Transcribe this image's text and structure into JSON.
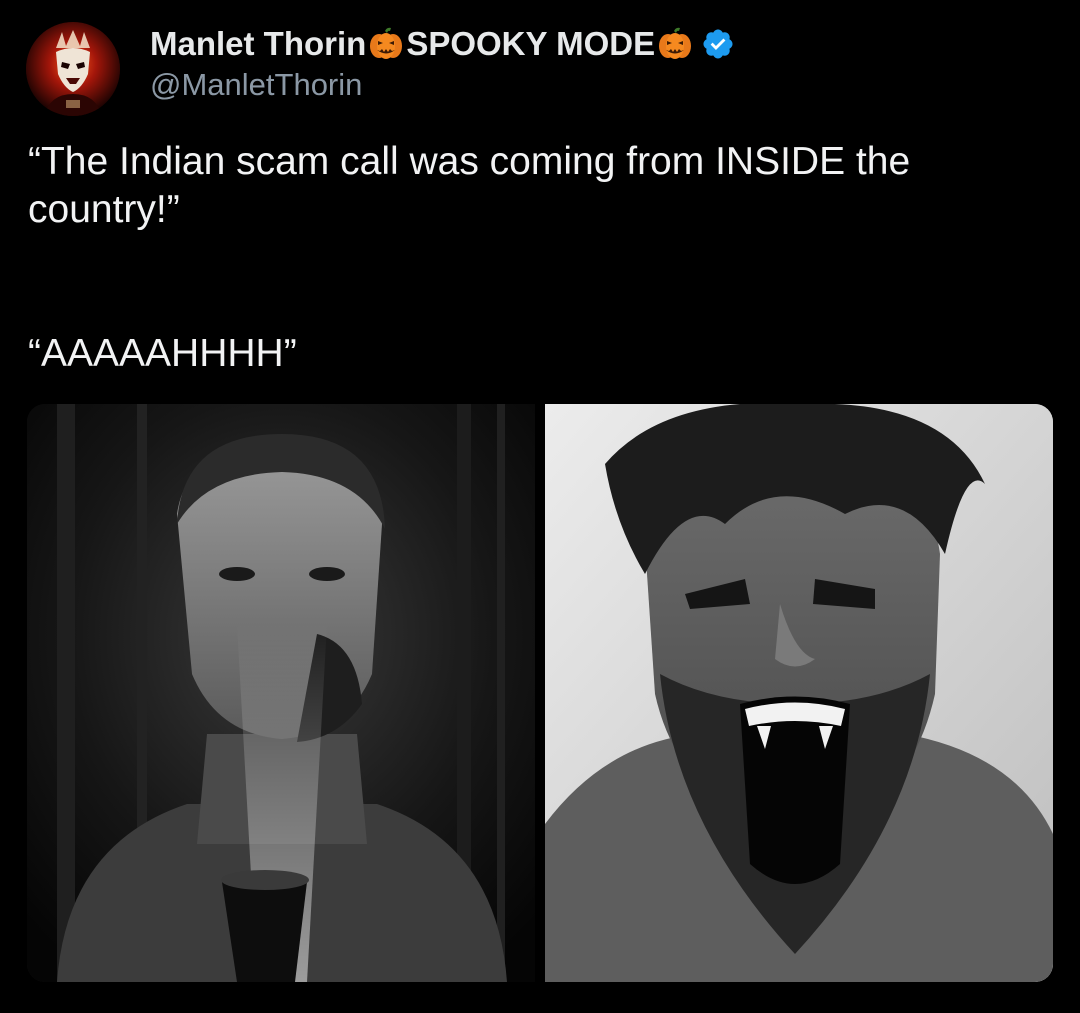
{
  "author": {
    "display_name": "Manlet Thorin ",
    "display_suffix": "SPOOKY MODE",
    "handle": "@ManletThorin",
    "verified": true,
    "avatar_icon": "demon-mask-avatar",
    "badge_icon": "pumpkin-emoji",
    "verified_icon": "verified-badge-icon"
  },
  "tweet": {
    "line1": "“The Indian scam call was coming from INSIDE the country!”",
    "line2": "“AAAAAHHHH”"
  },
  "media": {
    "left_image": "man-holding-flashlight-under-face-photo",
    "right_image": "man-screaming-with-fangs-photo"
  },
  "colors": {
    "background": "#000000",
    "text_primary": "#e7e9ea",
    "text_secondary": "#8b98a5",
    "verified_blue": "#1d9bf0",
    "pumpkin_orange": "#f5891f"
  }
}
